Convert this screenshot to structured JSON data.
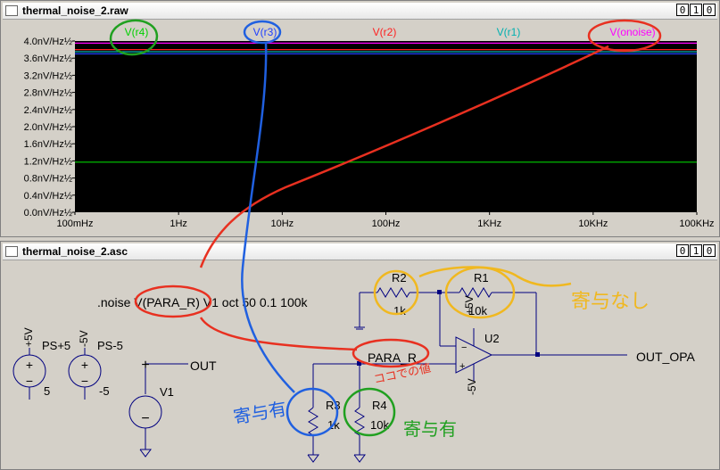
{
  "waveform_window": {
    "title": "thermal_noise_2.raw",
    "buttons": [
      "0",
      "1",
      "0"
    ],
    "traces": [
      {
        "label": "V(r4)",
        "color": "#00d000"
      },
      {
        "label": "V(r3)",
        "color": "#2040ff"
      },
      {
        "label": "V(r2)",
        "color": "#ff2020"
      },
      {
        "label": "V(r1)",
        "color": "#00b0b0"
      },
      {
        "label": "V(onoise)",
        "color": "#ff00ff"
      }
    ]
  },
  "chart_data": {
    "type": "line",
    "xscale": "log",
    "xlim": [
      0.1,
      100000
    ],
    "ylim": [
      0,
      4.0
    ],
    "ytick_labels": [
      "4.0nV/Hz½",
      "3.6nV/Hz½",
      "3.2nV/Hz½",
      "2.8nV/Hz½",
      "2.4nV/Hz½",
      "2.0nV/Hz½",
      "1.6nV/Hz½",
      "1.2nV/Hz½",
      "0.8nV/Hz½",
      "0.4nV/Hz½",
      "0.0nV/Hz½"
    ],
    "ytick_values": [
      4.0,
      3.6,
      3.2,
      2.8,
      2.4,
      2.0,
      1.6,
      1.2,
      0.8,
      0.4,
      0.0
    ],
    "xtick_labels": [
      "100mHz",
      "1Hz",
      "10Hz",
      "100Hz",
      "1KHz",
      "10KHz",
      "100KHz"
    ],
    "xtick_values": [
      0.1,
      1,
      10,
      100,
      1000,
      10000,
      100000
    ],
    "grid": true,
    "series": [
      {
        "name": "V(onoise)",
        "color": "#ff00ff",
        "x": [
          0.1,
          100000
        ],
        "y": [
          3.95,
          3.95
        ]
      },
      {
        "name": "V(r4)",
        "color": "#00d000",
        "x": [
          0.1,
          100000
        ],
        "y": [
          1.17,
          1.17
        ]
      },
      {
        "name": "V(r3)",
        "color": "#2040ff",
        "x": [
          0.1,
          100000
        ],
        "y": [
          3.7,
          3.7
        ]
      },
      {
        "name": "V(r2)",
        "color": "#ff2020",
        "x": [
          0.1,
          100000
        ],
        "y": [
          3.8,
          3.8
        ]
      },
      {
        "name": "V(r1)",
        "color": "#00b0b0",
        "x": [
          0.1,
          100000
        ],
        "y": [
          3.75,
          3.75
        ]
      }
    ]
  },
  "schematic_window": {
    "title": "thermal_noise_2.asc",
    "buttons": [
      "0",
      "1",
      "0"
    ],
    "noise_directive": ".noise V(PARA_R) V1 oct 50 0.1 100k",
    "components": {
      "r1": {
        "name": "R1",
        "value": "10k"
      },
      "r2": {
        "name": "R2",
        "value": "1k"
      },
      "r3": {
        "name": "R3",
        "value": "1k"
      },
      "r4": {
        "name": "R4",
        "value": "10k"
      },
      "u2": {
        "name": "U2"
      },
      "v1": {
        "name": "V1"
      },
      "ps_pos": {
        "name": "PS+5",
        "value": "5",
        "label": "+5V"
      },
      "ps_neg": {
        "name": "PS-5",
        "value": "-5",
        "label": "-5V"
      },
      "u2_pos_rail": "+5V",
      "u2_neg_rail": "-5V"
    },
    "net_labels": {
      "out": "OUT",
      "out_opa": "OUT_OPA",
      "para_r": "PARA_R"
    }
  },
  "annotations": {
    "no_contribution": "寄与なし",
    "contribution_left": "寄与有",
    "contribution_right": "寄与有",
    "noise_here": "ココでの値"
  }
}
